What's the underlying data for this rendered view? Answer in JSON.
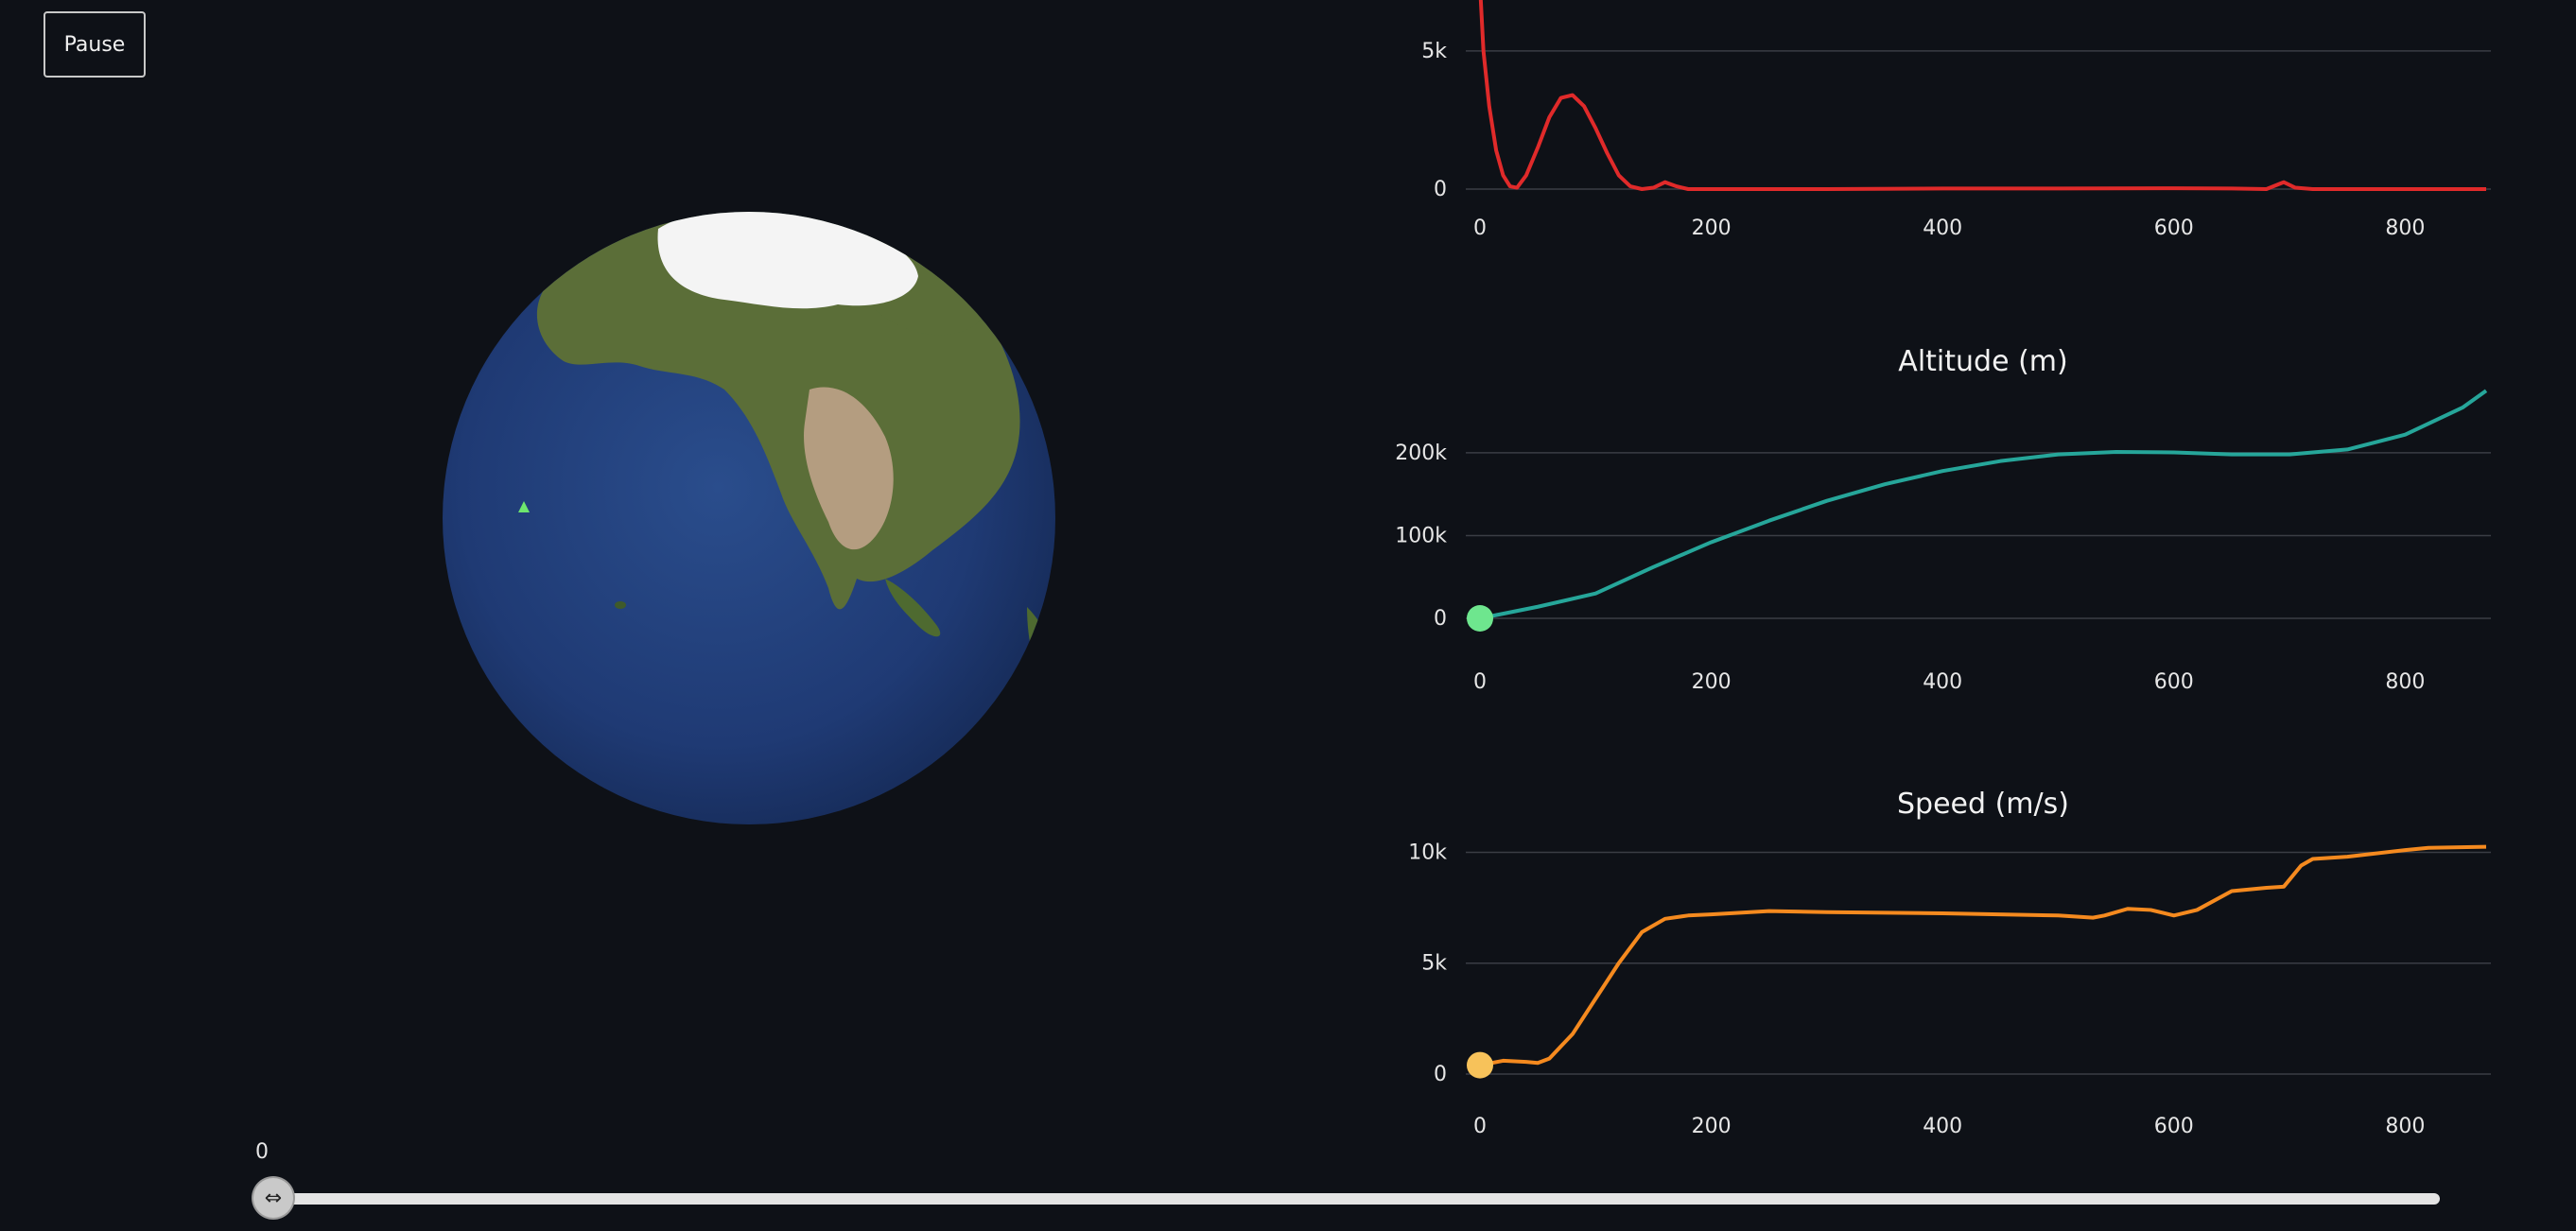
{
  "controls": {
    "pause_label": "Pause"
  },
  "globe": {
    "marker_icon": "rocket-position-marker-icon",
    "ocean_color": "#1f3a74",
    "land_color": "#5b6e38",
    "ice_color": "#f4f4f4",
    "marker_color": "#6ee66e"
  },
  "slider": {
    "value_label": "0",
    "value": 0,
    "thumb_icon": "horizontal-resize-icon"
  },
  "chart_data": [
    {
      "type": "line",
      "title": "",
      "color": "#e02a2a",
      "xticks": [
        "0",
        "200",
        "400",
        "600",
        "800"
      ],
      "yticks": [
        "0",
        "5k"
      ],
      "xlim": [
        0,
        870
      ],
      "ylim": [
        0,
        6500
      ],
      "x": [
        0,
        3,
        8,
        14,
        20,
        26,
        32,
        40,
        50,
        60,
        70,
        80,
        90,
        100,
        110,
        120,
        130,
        140,
        150,
        160,
        170,
        180,
        190,
        200,
        250,
        300,
        400,
        500,
        600,
        650,
        680,
        695,
        705,
        720,
        760,
        800,
        870
      ],
      "y": [
        7400,
        5000,
        3000,
        1400,
        500,
        100,
        50,
        500,
        1500,
        2600,
        3300,
        3400,
        3000,
        2200,
        1300,
        500,
        100,
        0,
        50,
        250,
        100,
        0,
        0,
        0,
        0,
        0,
        20,
        20,
        30,
        20,
        0,
        250,
        50,
        0,
        0,
        0,
        0
      ],
      "show_current_point": false
    },
    {
      "type": "line",
      "title": "Altitude (m)",
      "color": "#26a69a",
      "current_point_color": "#6ee68e",
      "current_x": 0,
      "current_y": 0,
      "xticks": [
        "0",
        "200",
        "400",
        "600",
        "800"
      ],
      "yticks": [
        "0",
        "100k",
        "200k"
      ],
      "xlim": [
        0,
        870
      ],
      "ylim": [
        0,
        265000
      ],
      "x": [
        0,
        50,
        100,
        150,
        200,
        250,
        300,
        350,
        400,
        450,
        500,
        550,
        600,
        650,
        700,
        750,
        800,
        850,
        870
      ],
      "y": [
        0,
        14000,
        30000,
        62000,
        92000,
        118000,
        142000,
        162000,
        178000,
        190000,
        198000,
        201000,
        200500,
        198000,
        198000,
        204000,
        222000,
        255000,
        275000
      ],
      "show_current_point": true
    },
    {
      "type": "line",
      "title": "Speed (m/s)",
      "color": "#f58a1f",
      "current_point_color": "#f7c25a",
      "current_x": 0,
      "current_y": 400,
      "xticks": [
        "0",
        "200",
        "400",
        "600",
        "800"
      ],
      "yticks": [
        "0",
        "5k",
        "10k"
      ],
      "xlim": [
        0,
        870
      ],
      "ylim": [
        0,
        11000
      ],
      "x": [
        0,
        20,
        40,
        50,
        60,
        80,
        100,
        120,
        140,
        160,
        180,
        200,
        250,
        300,
        400,
        500,
        530,
        540,
        560,
        580,
        600,
        620,
        650,
        680,
        695,
        710,
        720,
        750,
        800,
        820,
        870
      ],
      "y": [
        400,
        600,
        550,
        500,
        700,
        1800,
        3400,
        5000,
        6400,
        7000,
        7150,
        7200,
        7350,
        7300,
        7250,
        7150,
        7050,
        7150,
        7450,
        7400,
        7150,
        7400,
        8250,
        8400,
        8450,
        9400,
        9700,
        9800,
        10100,
        10200,
        10250
      ],
      "show_current_point": true
    }
  ]
}
